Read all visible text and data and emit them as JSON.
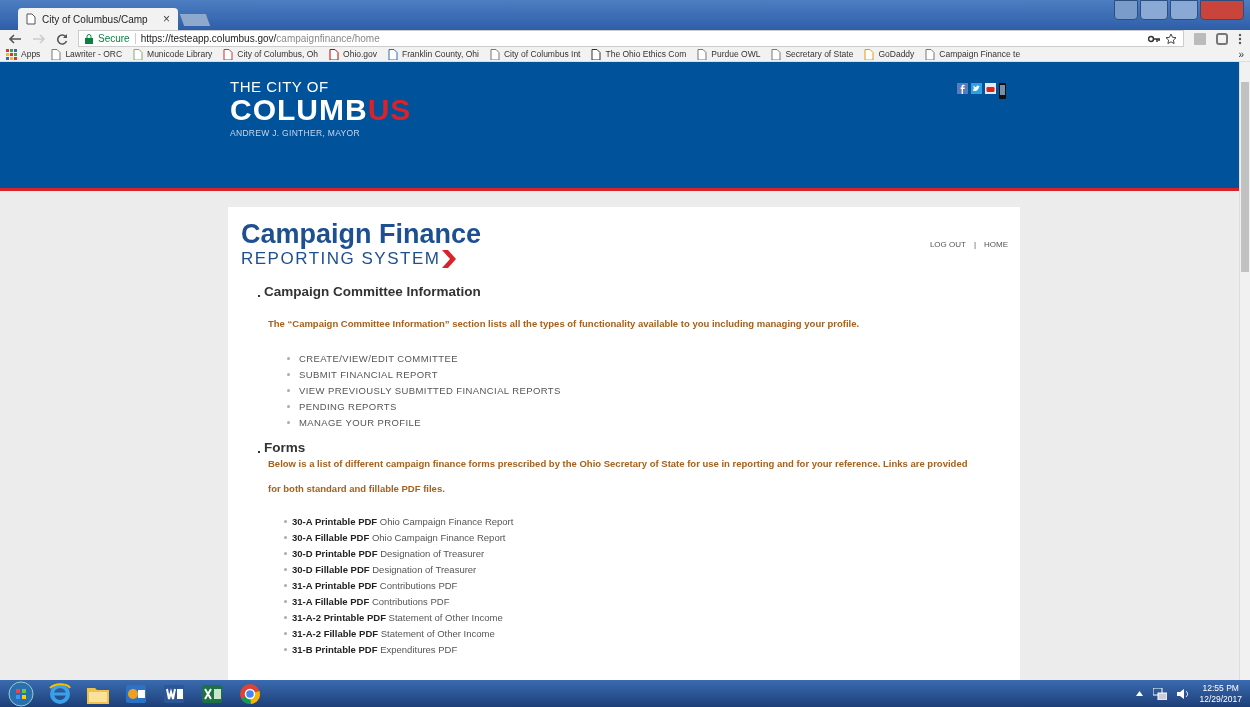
{
  "browser": {
    "tab_title": "City of Columbus/Camp",
    "tab_close": "×",
    "bookmarks_more": "»",
    "address": {
      "secure_label": "Secure",
      "url_host": "https://testeapp.columbus.gov/",
      "url_path": "campaignfinance/home"
    },
    "bookmarks": [
      "Apps",
      "Lawriter - ORC",
      "Municode Library",
      "City of Columbus, Oh",
      "Ohio.gov",
      "Franklin County, Ohi",
      "City of Columbus Int",
      "The Ohio Ethics Com",
      "Purdue OWL",
      "Secretary of State",
      "GoDaddy",
      "Campaign Finance te"
    ]
  },
  "header": {
    "city_of": "THE CITY OF",
    "wordmark": {
      "main": "COLUMB",
      "accent": "US"
    },
    "mayor": "ANDREW J. GINTHER, MAYOR"
  },
  "app_title": "Campaign Finance",
  "app_subtitle": "REPORTING SYSTEM",
  "nav_links": [
    "LOG OUT",
    "HOME"
  ],
  "nav_separator": "|",
  "sections": [
    {
      "heading": "Campaign Committee Information",
      "description": "The “Campaign Committee Information” section lists all the types of functionality available to you including managing your profile.",
      "kind": "menu",
      "items": [
        "CREATE/VIEW/EDIT COMMITTEE",
        "SUBMIT FINANCIAL REPORT",
        "VIEW PREVIOUSLY SUBMITTED FINANCIAL REPORTS",
        "PENDING REPORTS",
        "MANAGE YOUR PROFILE"
      ]
    },
    {
      "heading": "Forms",
      "description": "Below is a list of different campaign finance forms prescribed by the Ohio Secretary of State for use in reporting and for your reference. Links are provided for both standard and fillable PDF files.",
      "kind": "forms",
      "items": [
        "**30-A Printable PDF** Ohio Campaign Finance Report",
        "**30-A Fillable PDF** Ohio Campaign Finance Report",
        "**30-D Printable PDF** Designation of Treasurer",
        "**30-D Fillable PDF** Designation of Treasurer",
        "**31-A Printable PDF** Contributions PDF",
        "**31-A Fillable PDF** Contributions PDF",
        "**31-A-2 Printable PDF** Statement of Other Income",
        "**31-A-2 Fillable PDF** Statement of Other Income",
        "**31-B Printable PDF** Expenditures PDF"
      ]
    }
  ],
  "taskbar": {
    "time": "12:55 PM",
    "date": "12/29/2017"
  }
}
